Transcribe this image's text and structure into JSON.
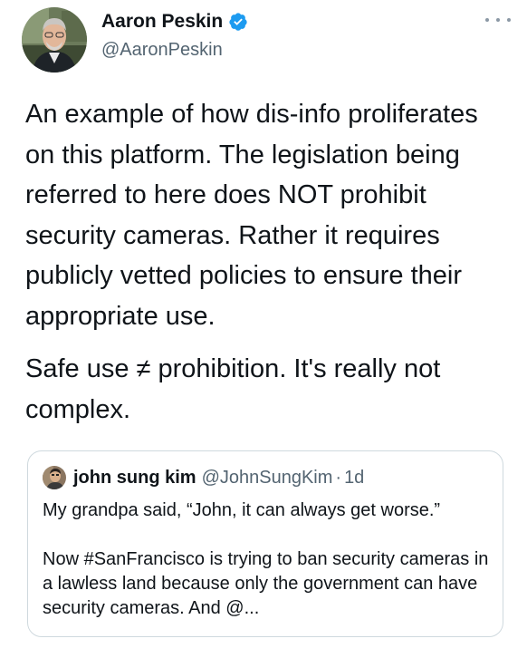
{
  "tweet": {
    "author": {
      "name": "Aaron Peskin",
      "handle": "@AaronPeskin",
      "verified": true,
      "avatar_icon": "profile-photo"
    },
    "more_icon": "ellipsis-icon",
    "paragraphs": [
      "An example of how dis-info proliferates on this platform. The legislation being referred to here does NOT prohibit security cameras. Rather it requires publicly vetted policies to ensure their appropriate use.",
      "Safe use ≠ prohibition. It's really not complex."
    ]
  },
  "quoted_tweet": {
    "author": {
      "name": "john sung kim",
      "handle": "@JohnSungKim",
      "separator": "·",
      "time": "1d",
      "avatar_icon": "profile-photo"
    },
    "paragraphs": [
      "My grandpa said, “John, it can always get worse.”",
      "Now #SanFrancisco is trying to ban security cameras in a lawless land because only the government can have security cameras. And @..."
    ]
  },
  "colors": {
    "text": "#0f1419",
    "secondary": "#536471",
    "verified_blue": "#1d9bf0",
    "border": "#cfd9de"
  }
}
